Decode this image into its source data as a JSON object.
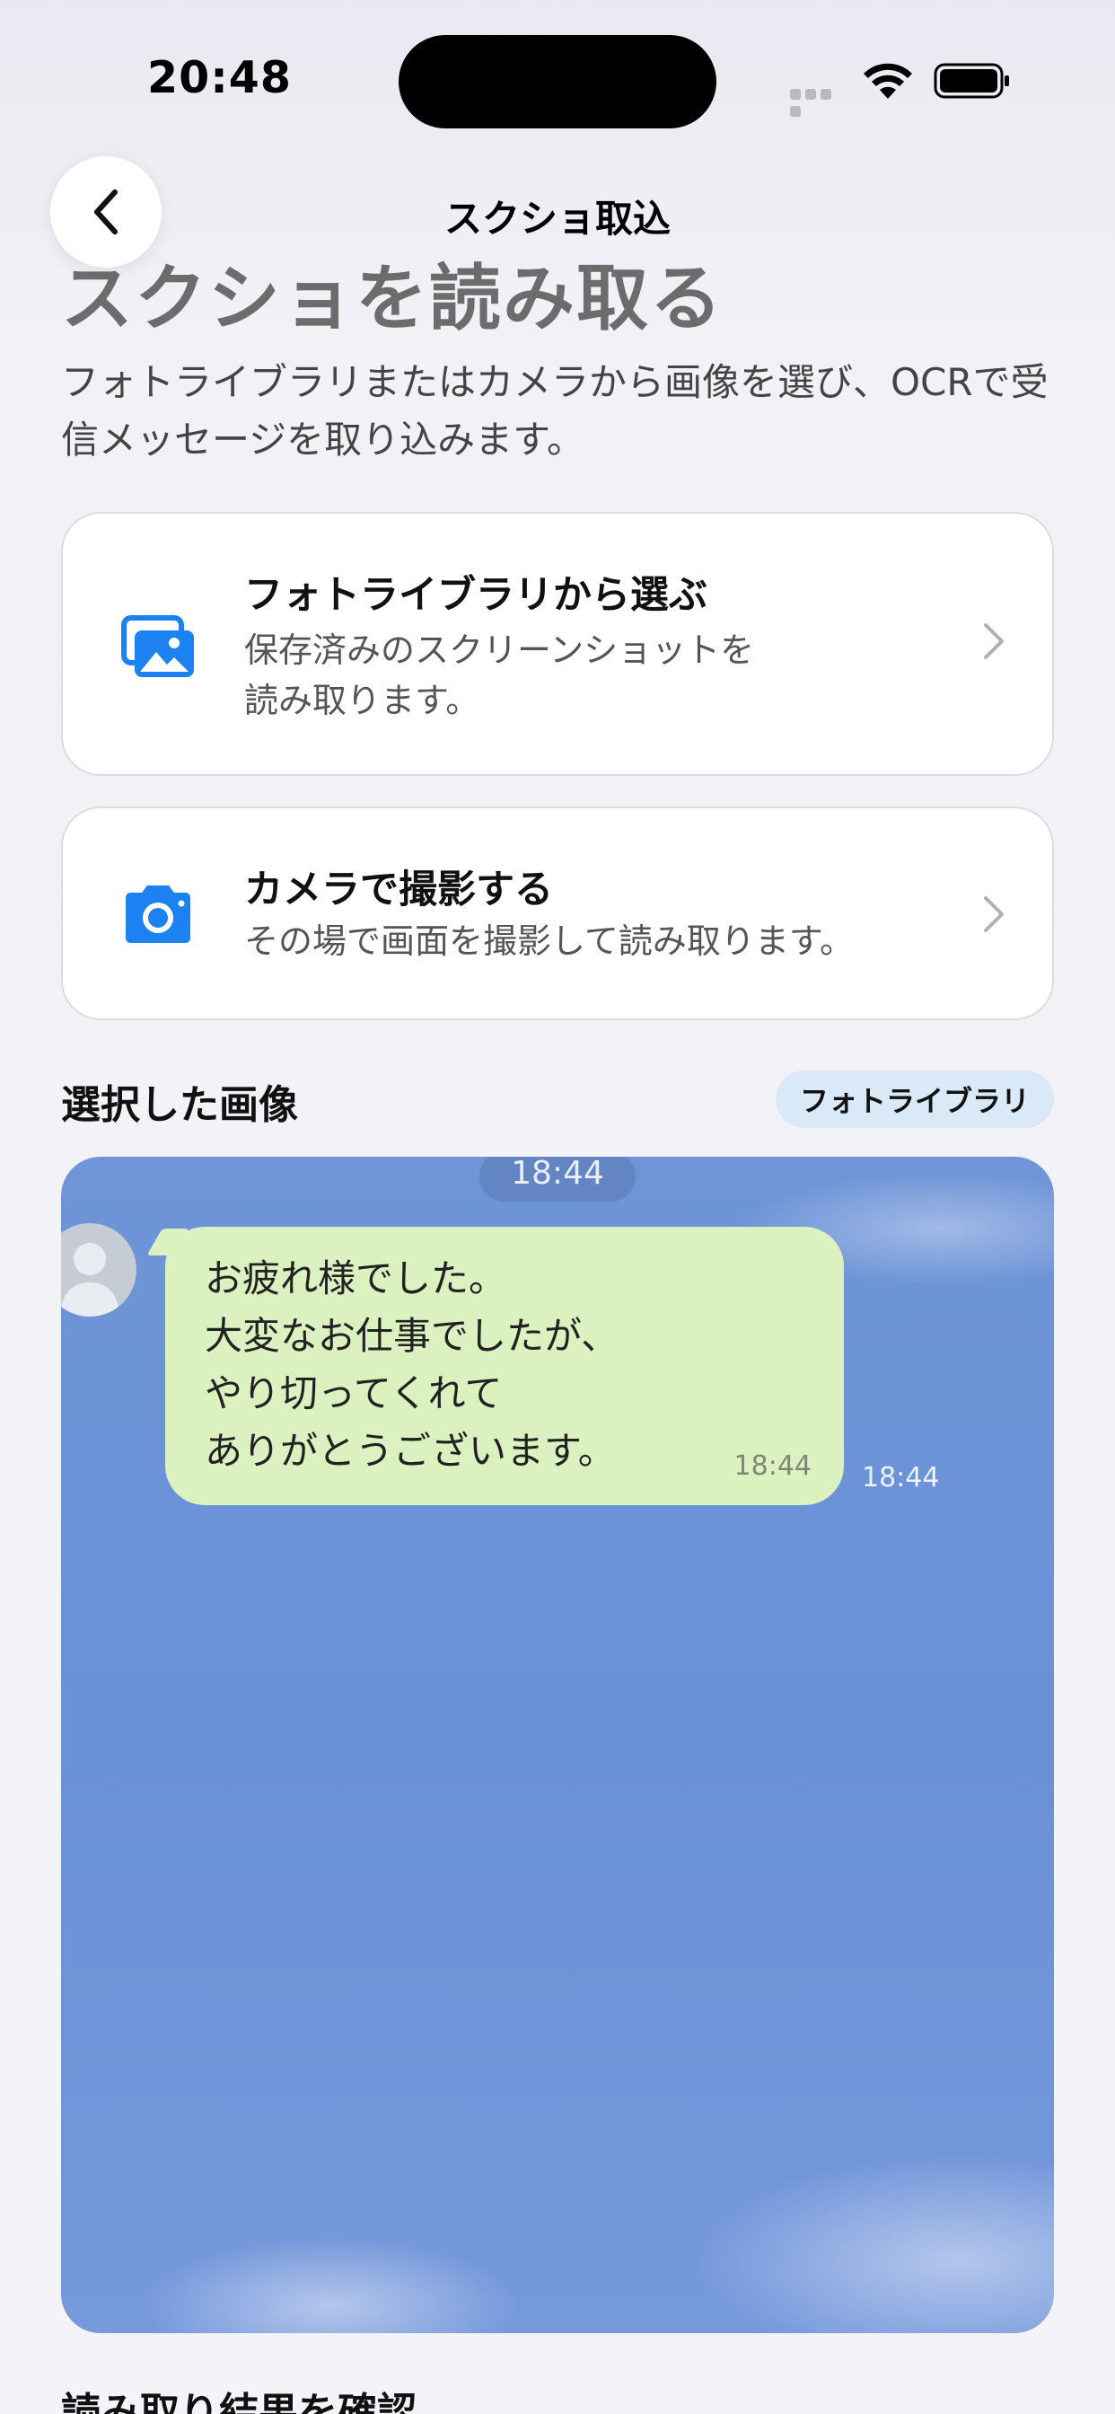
{
  "status_bar": {
    "time": "20:48"
  },
  "nav": {
    "title": "スクショ取込"
  },
  "header": {
    "title": "スクショを読み取る",
    "description": "フォトライブラリまたはカメラから画像を選び、OCRで受信メッセージを取り込みます。"
  },
  "options": [
    {
      "title": "フォトライブラリから選ぶ",
      "description": "保存済みのスクリーンショットを読み取ります。",
      "icon": "photo-library-icon"
    },
    {
      "title": "カメラで撮影する",
      "description": "その場で画面を撮影して読み取ります。",
      "icon": "camera-icon"
    }
  ],
  "selected": {
    "title": "選択した画像",
    "source_badge": "フォトライブラリ",
    "message": {
      "time_top": "18:44",
      "lines": [
        "お疲れ様でした。",
        "大変なお仕事でしたが、",
        "やり切ってくれて",
        "ありがとうございます。"
      ],
      "bubble_time": "18:44",
      "outer_time": "18:44"
    }
  },
  "result": {
    "title": "読み取り結果を確認"
  },
  "colors": {
    "accent": "#1c82f2",
    "bubble": "#dbf1c0",
    "badge_bg": "#d9e9f8"
  }
}
